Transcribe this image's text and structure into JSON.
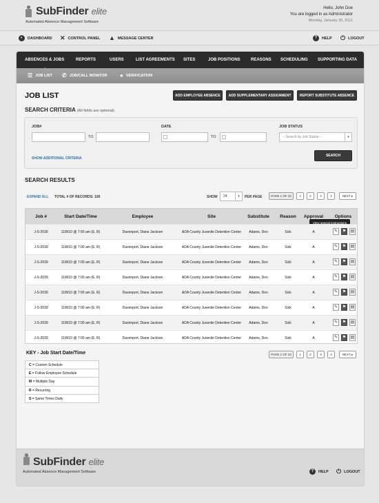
{
  "header": {
    "brand": "SubFinder",
    "brand_suffix": "elite",
    "tagline": "Automated Absence Management Software",
    "greeting": "Hello, John Doe",
    "role_line": "You are logged in as Administrator",
    "date": "Monday, January 30, 2011"
  },
  "topbar": {
    "dashboard": "DASHBOARD",
    "control_panel": "CONTROL PANEL",
    "message_center": "MESSAGE CENTER",
    "help": "HELP",
    "logout": "LOGOUT"
  },
  "mainnav": [
    "ABSENCES & JOBS",
    "REPORTS",
    "USERS",
    "LIST AGREEMENTS",
    "SITES",
    "JOB POSITIONS",
    "REASONS",
    "SCHEDULING",
    "SUPPORTING DATA"
  ],
  "subnav": [
    "JOB LIST",
    "JOB/CALL MONITOR",
    "VERIFICATION"
  ],
  "page": {
    "title": "JOB LIST",
    "btn_add_employee": "ADD EMPLOYEE ABSENCE",
    "btn_add_supp": "ADD SUPPLEMENTARY ASSIGNMENT",
    "btn_report_sub": "REPORT SUBSTITUTE ABSENCE"
  },
  "criteria": {
    "title": "SEARCH CRITERIA",
    "note": "(All fields are optional)",
    "job_label": "JOB#",
    "date_label": "DATE",
    "status_label": "JOB STATUS",
    "to": "TO",
    "status_placeholder": "-- Search by Job Status--",
    "show_additional": "SHOW ADDITIONAL CRITERIA",
    "search_btn": "SEARCH"
  },
  "results": {
    "title": "SEARCH RESULTS",
    "expand_all": "EXPAND ALL",
    "total_label": "TOTAL # OF RECORDS:",
    "total_value": "100",
    "show_label": "SHOW",
    "show_value": "24",
    "per_page": "PER PAGE",
    "page_of": "PAGE 1 OF 22",
    "pages": [
      "1",
      "2",
      "3",
      "4"
    ],
    "next": "NEXT"
  },
  "table": {
    "headers": [
      "Job #",
      "Start Date/Time",
      "Employee",
      "Site",
      "Substitute",
      "Reason",
      "Approval",
      "Options"
    ],
    "rows": [
      [
        "J-S-2039",
        "11/8/10 @ 7:00 am (E, R)",
        "Davenport, Diane Jackson",
        "ADA County Juvenile Detention Center",
        "Adams, Don",
        "Sick",
        "A"
      ],
      [
        "J-S-2039",
        "11/8/10 @ 7:00 am (E, R)",
        "Davenport, Diane Jackson",
        "ADA County Juvenile Detention Center",
        "Adams, Don",
        "Sick",
        "A"
      ],
      [
        "J-S-2039",
        "11/8/10 @ 7:00 am (E, R)",
        "Davenport, Diane Jackson",
        "ADA County Juvenile Detention Center",
        "Adams, Don",
        "Sick",
        "A"
      ],
      [
        "J-S-2039",
        "11/8/10 @ 7:00 am (E, R)",
        "Davenport, Diane Jackson",
        "ADA County Juvenile Detention Center",
        "Adams, Don",
        "Sick",
        "A"
      ],
      [
        "J-S-2039",
        "11/8/10 @ 7:00 am (E, R)",
        "Davenport, Diane Jackson",
        "ADA County Juvenile Detention Center",
        "Adams, Don",
        "Sick",
        "A"
      ],
      [
        "J-S-2039",
        "11/8/10 @ 7:00 am (E, R)",
        "Davenport, Diane Jackson",
        "ADA County Juvenile Detention Center",
        "Adams, Don",
        "Sick",
        "A"
      ],
      [
        "J-S-2039",
        "11/8/10 @ 7:00 am (E, R)",
        "Davenport, Diane Jackson",
        "ADA County Juvenile Detention Center",
        "Adams, Don",
        "Sick",
        "A"
      ],
      [
        "J-S-2039",
        "11/8/10 @ 7:00 am (E, R)",
        "Davenport, Diane Jackson",
        "ADA County Juvenile Detention Center",
        "Adams, Don",
        "Sick",
        "A"
      ]
    ],
    "tooltip": "View special instructions"
  },
  "key": {
    "title": "KEY - Job Start Date/Time",
    "items": [
      {
        "code": "C",
        "text": "= Custom Schedule"
      },
      {
        "code": "E",
        "text": "= Follow Employee Schedule"
      },
      {
        "code": "M",
        "text": "= Multiple Day"
      },
      {
        "code": "R",
        "text": "= Recurring"
      },
      {
        "code": "S",
        "text": "= Same Times Daily"
      }
    ]
  },
  "footer": {
    "brand": "SubFinder",
    "brand_suffix": "elite",
    "tagline": "Automated Absence Management Software",
    "help": "HELP",
    "logout": "LOGOUT"
  },
  "icons": [
    "person-logo-icon",
    "dashboard-icon",
    "tools-icon",
    "warning-icon",
    "help-icon",
    "power-icon",
    "list-icon",
    "phone-icon",
    "user-icon",
    "calendar-icon",
    "edit-icon",
    "flag-icon",
    "document-icon"
  ]
}
